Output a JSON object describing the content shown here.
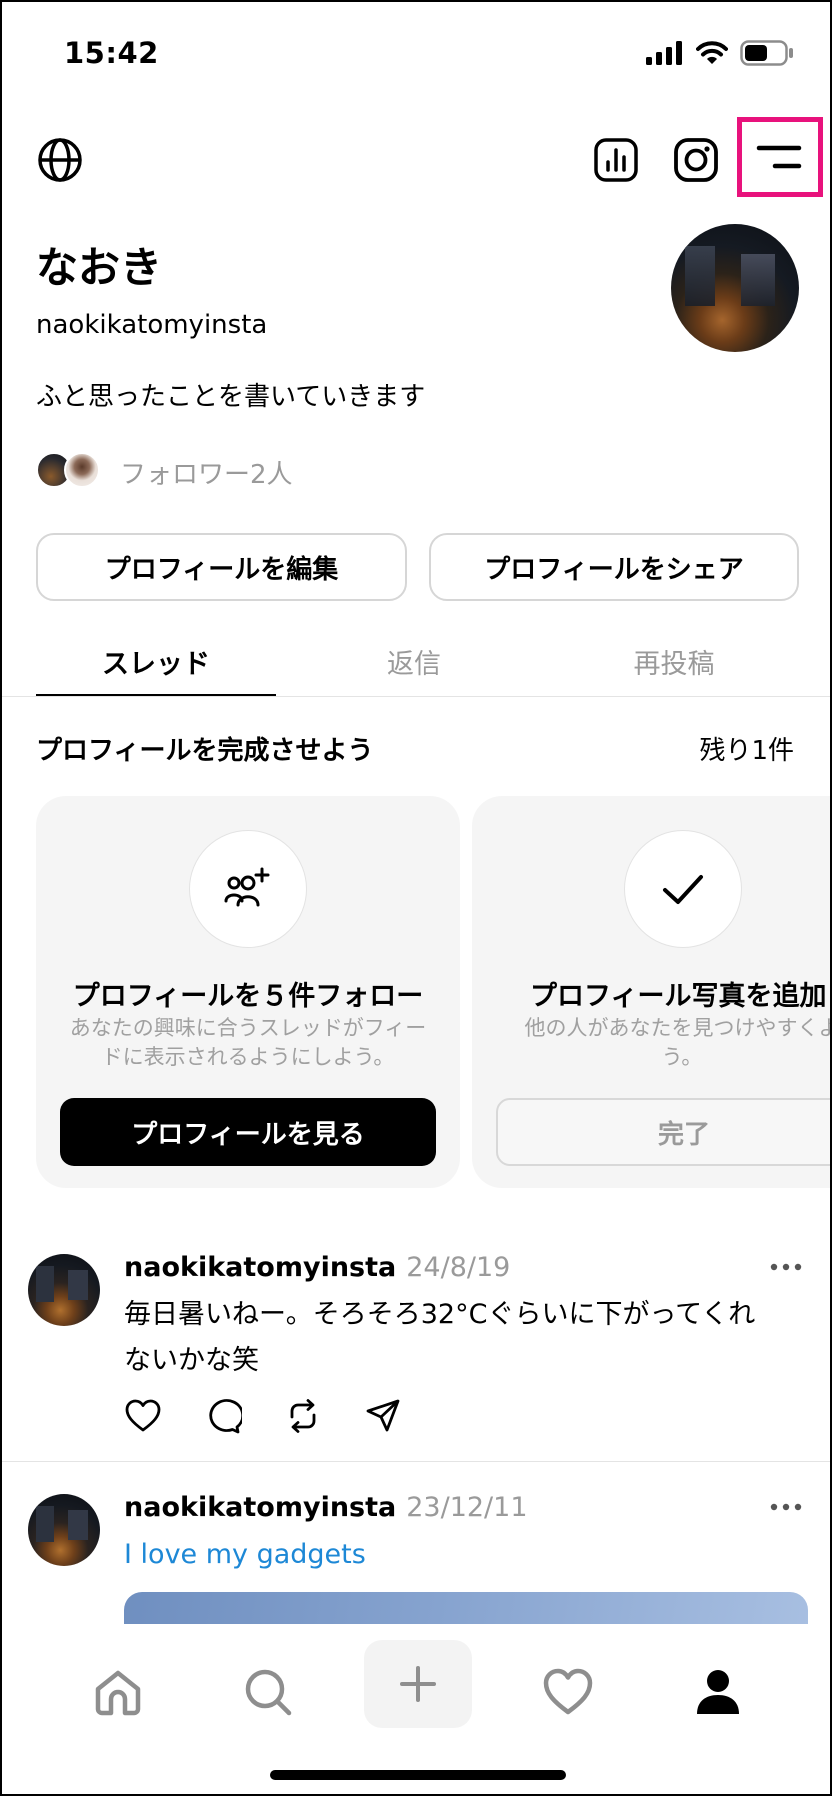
{
  "status_bar": {
    "time": "15:42"
  },
  "profile": {
    "display_name": "なおき",
    "username": "naokikatomyinsta",
    "bio": "ふと思ったことを書いていきます",
    "followers": "フォロワー2人",
    "edit_button": "プロフィールを編集",
    "share_button": "プロフィールをシェア"
  },
  "tabs": [
    "スレッド",
    "返信",
    "再投稿"
  ],
  "completion": {
    "title": "プロフィールを完成させよう",
    "remaining": "残り1件",
    "cards": [
      {
        "icon": "add-people-icon",
        "title": "プロフィールを５件フォロー",
        "description": "あなたの興味に合うスレッドがフィードに表示されるようにしよう。",
        "button": "プロフィールを見る"
      },
      {
        "icon": "checkmark-icon",
        "title": "プロフィール写真を追加",
        "description": "他の人があなたを見つけやすくよう。",
        "button": "完了"
      }
    ]
  },
  "posts": [
    {
      "username": "naokikatomyinsta",
      "date": "24/8/19",
      "text_line1": "毎日暑いねー。そろそろ32°Cぐらいに下がってくれ",
      "text_line2": "ないかな笑"
    },
    {
      "username": "naokikatomyinsta",
      "date": "23/12/11",
      "text": "I love my gadgets"
    }
  ],
  "colors": {
    "highlight": "#e8127c",
    "link": "#1d88d6",
    "muted": "#9a9a9a"
  }
}
